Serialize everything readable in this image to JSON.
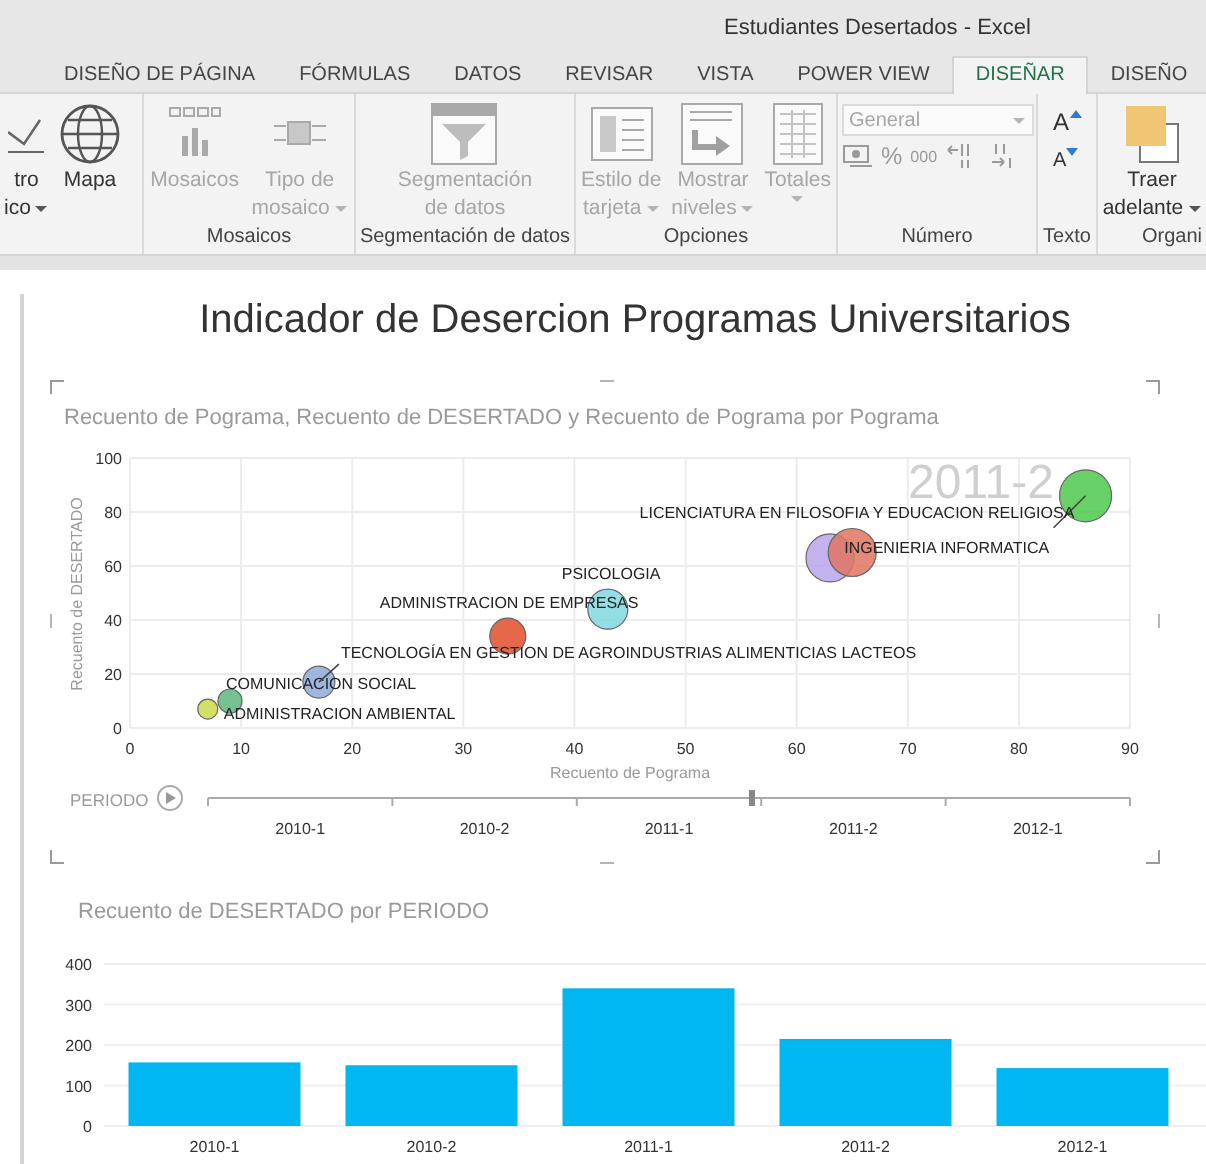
{
  "window": {
    "title": "Estudiantes Desertados - Excel"
  },
  "tabs": [
    {
      "label": "DISEÑO DE PÁGINA",
      "selected": false
    },
    {
      "label": "FÓRMULAS",
      "selected": false
    },
    {
      "label": "DATOS",
      "selected": false
    },
    {
      "label": "REVISAR",
      "selected": false
    },
    {
      "label": "VISTA",
      "selected": false
    },
    {
      "label": "POWER VIEW",
      "selected": false
    },
    {
      "label": "DISEÑAR",
      "selected": true
    },
    {
      "label": "DISEÑO",
      "selected": false
    }
  ],
  "ribbon": {
    "groups": [
      {
        "kind": "buttons",
        "buttons": [
          {
            "lines": [
              "tro",
              "ico"
            ],
            "dropdown": true,
            "disabled": false
          },
          {
            "lines": [
              "Mapa"
            ],
            "dropdown": false,
            "disabled": false
          }
        ]
      },
      {
        "kind": "buttons",
        "label": "Mosaicos",
        "buttons": [
          {
            "lines": [
              "Mosaicos"
            ],
            "dropdown": false,
            "disabled": true
          },
          {
            "lines": [
              "Tipo de",
              "mosaico"
            ],
            "dropdown": true,
            "disabled": true
          }
        ]
      },
      {
        "kind": "buttons",
        "label": "Segmentación de datos",
        "buttons": [
          {
            "lines": [
              "Segmentación",
              "de datos"
            ],
            "dropdown": false,
            "disabled": true
          }
        ]
      },
      {
        "kind": "buttons",
        "label": "Opciones",
        "buttons": [
          {
            "lines": [
              "Estilo de",
              "tarjeta"
            ],
            "dropdown": true,
            "disabled": true
          },
          {
            "lines": [
              "Mostrar",
              "niveles"
            ],
            "dropdown": true,
            "disabled": true
          },
          {
            "lines": [
              "Totales"
            ],
            "dropdown": true,
            "disabled": true
          }
        ]
      },
      {
        "kind": "number",
        "label": "Número",
        "format": {
          "value": "General",
          "disabled": true
        },
        "buttons": [
          {
            "kind": "icon",
            "disabled": true
          },
          {
            "kind": "text",
            "text": "%",
            "disabled": true
          },
          {
            "kind": "text",
            "text": "000",
            "disabled": true
          },
          {
            "kind": "icon",
            "disabled": true
          },
          {
            "kind": "icon",
            "disabled": true
          }
        ]
      },
      {
        "kind": "font",
        "label": "Texto",
        "buttons": [
          {
            "text": "A",
            "disabled": false
          },
          {
            "text": "A",
            "disabled": false
          }
        ]
      },
      {
        "kind": "buttons",
        "label": "Organi",
        "buttons": [
          {
            "lines": [
              "Traer",
              "adelante"
            ],
            "dropdown": true,
            "disabled": false
          }
        ]
      }
    ]
  },
  "report": {
    "title": "Indicador de Desercion Programas Universitarios",
    "scatter": {
      "watermark": "2011-2",
      "chart_data": {
        "type": "scatter",
        "grid": true,
        "title": "Recuento de Pograma, Recuento de DESERTADO y Recuento de Pograma por Pograma",
        "xlabel": "Recuento de Pograma",
        "ylabel": "Recuento de DESERTADO",
        "xlim": [
          0,
          90
        ],
        "ylim": [
          0,
          100
        ],
        "xticks": [
          0,
          10,
          20,
          30,
          40,
          50,
          60,
          70,
          80,
          90
        ],
        "yticks": [
          0,
          20,
          40,
          60,
          80,
          100
        ],
        "series": [
          {
            "name": "ADMINISTRACION AMBIENTAL",
            "color": "#c8dc4a",
            "x": [
              7
            ],
            "values": [
              7
            ]
          },
          {
            "name": "COMUNICACION SOCIAL",
            "color": "#5fb57e",
            "x": [
              9
            ],
            "values": [
              10
            ]
          },
          {
            "name": "TECNOLOGÍA EN GESTION DE AGROINDUSTRIAS ALIMENTICIAS LACTEOS",
            "color": "#8eaad8",
            "x": [
              17
            ],
            "values": [
              17
            ]
          },
          {
            "name": "ADMINISTRACION DE EMPRESAS",
            "color": "#e04e2a",
            "x": [
              34
            ],
            "values": [
              34
            ]
          },
          {
            "name": "PSICOLOGIA",
            "color": "#80d8e0",
            "x": [
              43
            ],
            "values": [
              44
            ]
          },
          {
            "color": "#b9a4ea",
            "x": [
              63
            ],
            "values": [
              63
            ]
          },
          {
            "name": "INGENIERIA INFORMATICA",
            "color": "#e07462",
            "x": [
              65
            ],
            "values": [
              65
            ]
          },
          {
            "name": "LICENCIATURA EN FILOSOFIA Y EDUCACION RELIGIOSA",
            "color": "#4cc94c",
            "x": [
              86
            ],
            "values": [
              86
            ]
          }
        ]
      },
      "play_axis": {
        "label": "PERIODO",
        "level": 0.59,
        "periods": [
          "2010-1",
          "2010-2",
          "2011-1",
          "2011-2",
          "2012-1"
        ]
      }
    },
    "bar": {
      "chart_data": {
        "type": "bar",
        "grid": true,
        "title": "Recuento de DESERTADO por PERIODO",
        "categories": [
          "2010-1",
          "2010-2",
          "2011-1",
          "2011-2",
          "2012-1"
        ],
        "ylim": [
          0,
          400
        ],
        "yticks": [
          0,
          100,
          200,
          300,
          400
        ],
        "series": [
          {
            "color": "#00b7f1",
            "values": [
              157,
              150,
              340,
              215,
              143
            ]
          }
        ]
      }
    }
  }
}
